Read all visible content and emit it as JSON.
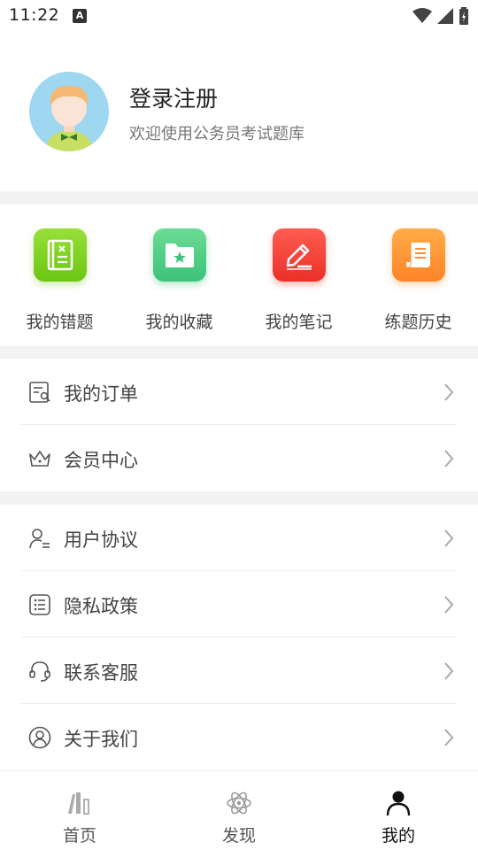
{
  "status_bar": {
    "time": "11:22",
    "notification_icon": "A"
  },
  "profile": {
    "title": "登录注册",
    "subtitle": "欢迎使用公务员考试题库"
  },
  "quick_actions": [
    {
      "label": "我的错题",
      "icon": "wrong-questions-icon",
      "color": "#7ed321"
    },
    {
      "label": "我的收藏",
      "icon": "favorites-folder-icon",
      "color": "#4cd080"
    },
    {
      "label": "我的笔记",
      "icon": "notes-pen-icon",
      "color": "#f5433b"
    },
    {
      "label": "练题历史",
      "icon": "history-scroll-icon",
      "color": "#ff9430"
    }
  ],
  "menu_group_1": [
    {
      "label": "我的订单",
      "icon": "order-icon"
    },
    {
      "label": "会员中心",
      "icon": "crown-icon"
    }
  ],
  "menu_group_2": [
    {
      "label": "用户协议",
      "icon": "user-agreement-icon"
    },
    {
      "label": "隐私政策",
      "icon": "privacy-list-icon"
    },
    {
      "label": "联系客服",
      "icon": "headset-icon"
    },
    {
      "label": "关于我们",
      "icon": "about-user-icon"
    }
  ],
  "bottom_nav": {
    "items": [
      {
        "label": "首页",
        "icon": "books-icon",
        "active": false
      },
      {
        "label": "发现",
        "icon": "atom-icon",
        "active": false
      },
      {
        "label": "我的",
        "icon": "person-icon",
        "active": true
      }
    ]
  }
}
